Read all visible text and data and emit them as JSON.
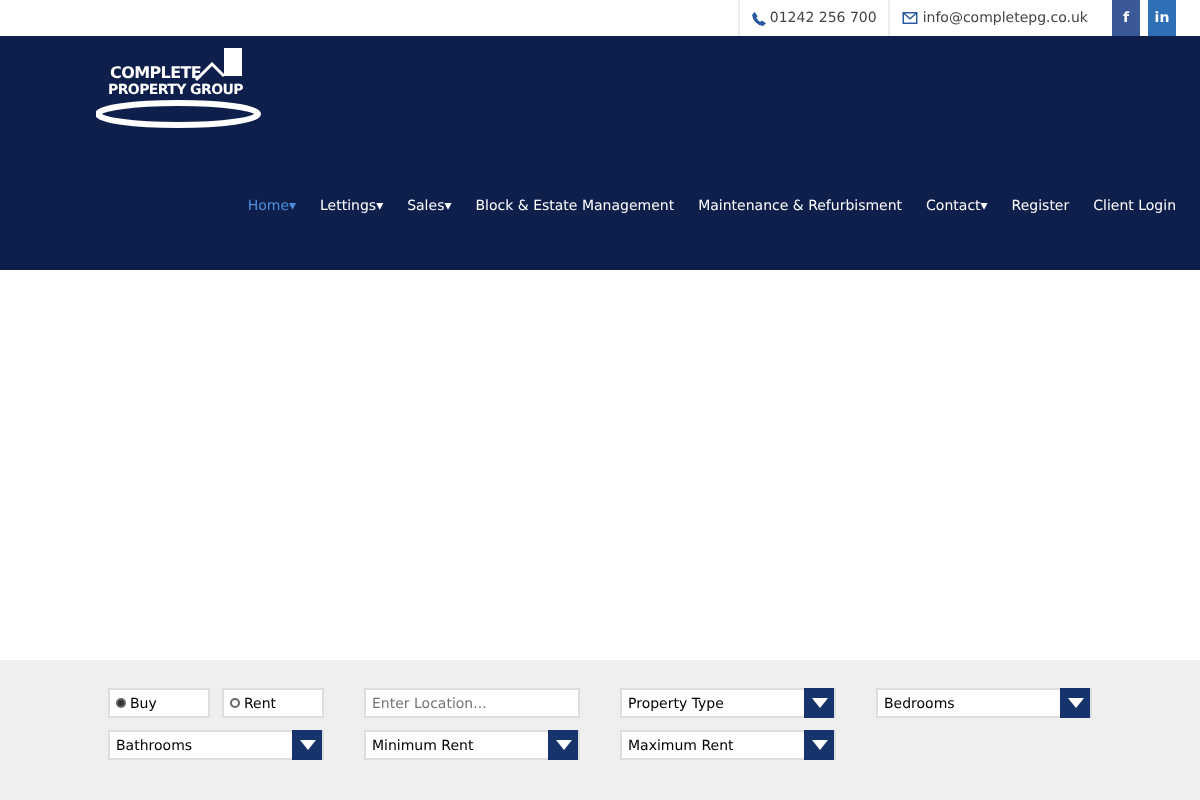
{
  "topbar": {
    "phone": "01242 256 700",
    "email": "info@completepg.co.uk",
    "social": [
      {
        "label": "f"
      },
      {
        "label": "in"
      }
    ]
  },
  "logo": {
    "line1": "COMPLETE",
    "line2": "PROPERTY GROUP"
  },
  "nav": [
    {
      "label": "Home",
      "caret": "▾",
      "selected": true
    },
    {
      "label": "Lettings",
      "caret": "▾",
      "selected": false
    },
    {
      "label": "Sales",
      "caret": "▾",
      "selected": false
    },
    {
      "label": "Block & Estate Management",
      "selected": false
    },
    {
      "label": "Maintenance & Refurbisment",
      "selected": false
    },
    {
      "label": "Contact",
      "caret": "▾",
      "selected": false
    },
    {
      "label": "Register",
      "selected": false
    },
    {
      "label": "Client Login",
      "selected": false
    }
  ],
  "search": {
    "modes": [
      {
        "label": "Buy",
        "selected": true
      },
      {
        "label": "Rent",
        "selected": false
      }
    ],
    "location": {
      "placeholder": "Enter Location..."
    },
    "selects": [
      {
        "label": "Property Type"
      },
      {
        "label": "Bedrooms"
      },
      {
        "label": "Bathrooms"
      },
      {
        "label": "Minimum Rent"
      },
      {
        "label": "Maximum Rent"
      }
    ]
  }
}
